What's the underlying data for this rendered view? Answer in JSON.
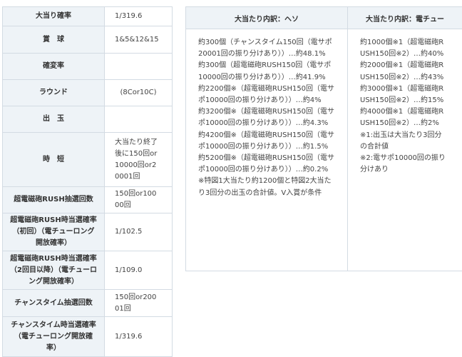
{
  "spec_rows": [
    {
      "key": "大当り確率",
      "value": "1/319.6",
      "center": false
    },
    {
      "key": "賞　球",
      "value": "1&5&12&15",
      "center": false
    },
    {
      "key": "確変率",
      "value": "",
      "center": false
    },
    {
      "key": "ラウンド",
      "value": "(8Cor10C)",
      "center": true
    },
    {
      "key": "出　玉",
      "value": "",
      "center": false
    },
    {
      "key": "時　短",
      "value": "大当たり終了後に150回or10000回or20001回",
      "center": false
    },
    {
      "key": "超電磁砲RUSH抽選回数",
      "value": "150回or10000回",
      "center": false
    },
    {
      "key": "超電磁砲RUSH時当選確率（初回）（電チューロング開放確率）",
      "value": "1/102.5",
      "center": false
    },
    {
      "key": "超電磁砲RUSH時当選確率（2回目以降）（電チューロング開放確率）",
      "value": "1/109.0",
      "center": false
    },
    {
      "key": "チャンスタイム抽選回数",
      "value": "150回or20001回",
      "center": false
    },
    {
      "key": "チャンスタイム時当選確率（電チューロング開放確率）",
      "value": "1/319.6",
      "center": false
    }
  ],
  "breakdown": {
    "heso_header": "大当たり内訳：ヘソ",
    "denchu_header": "大当たり内訳：電チュー",
    "heso_lines": [
      "約300個（チャンスタイム150回（電サポ20001回の振り分けあり））…約48.1%",
      "約300個（超電磁砲RUSH150回（電サポ10000回の振り分けあり））…約41.9%",
      "約2200個※（超電磁砲RUSH150回（電サポ10000回の振り分けあり））…約4%",
      "約3200個※（超電磁砲RUSH150回（電サポ10000回の振り分けあり））…約4.3%",
      "約4200個※（超電磁砲RUSH150回（電サポ10000回の振り分けあり））…約1.5%",
      "約5200個※（超電磁砲RUSH150回（電サポ10000回の振り分けあり））…約0.2%",
      "※特図1大当たり約1200個と特図2大当たり3回分の出玉の合計値。V入賞が条件"
    ],
    "denchu_lines": [
      "約1000個※1（超電磁砲RUSH150回※2）…約40%",
      "約2000個※1（超電磁砲RUSH150回※2）…約43%",
      "約3000個※1（超電磁砲RUSH150回※2）…約15%",
      "約4000個※1（超電磁砲RUSH150回※2）…約2%",
      "※1:出玉は大当たり3回分の合計値",
      "※2:電サポ10000回の振り分けあり"
    ]
  }
}
